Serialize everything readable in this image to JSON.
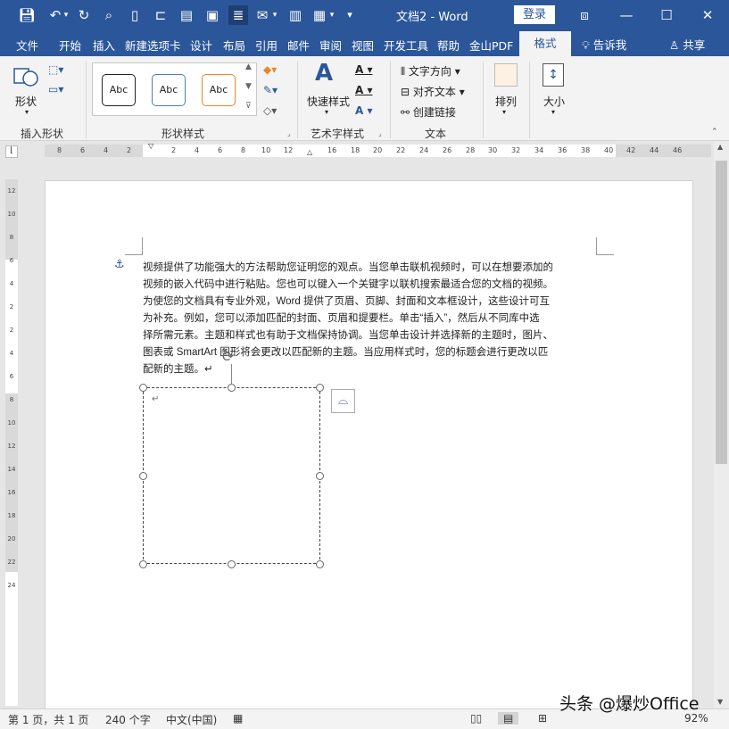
{
  "titlebar": {
    "doc_title": "文档2  -  Word",
    "login_label": "登录"
  },
  "tabs": [
    "文件",
    "开始",
    "插入",
    "新建选项卡",
    "设计",
    "布局",
    "引用",
    "邮件",
    "审阅",
    "视图",
    "开发工具",
    "帮助",
    "金山PDF",
    "格式"
  ],
  "tell_me": "告诉我",
  "share": "共享",
  "ribbon": {
    "insert_shapes": {
      "shape_label": "形状",
      "group_label": "插入形状"
    },
    "shape_styles": {
      "sample_text": "Abc",
      "group_label": "形状样式"
    },
    "wordart": {
      "quick_styles_label": "快速样式",
      "group_label": "艺术字样式"
    },
    "text": {
      "direction_label": "文字方向",
      "align_label": "对齐文本",
      "link_label": "创建链接",
      "group_label": "文本"
    },
    "arrange": {
      "label": "排列"
    },
    "size": {
      "label": "大小"
    }
  },
  "ruler_h": [
    "8",
    "6",
    "4",
    "2",
    "2",
    "4",
    "6",
    "8",
    "10",
    "12",
    "16",
    "18",
    "20",
    "22",
    "24",
    "26",
    "28",
    "30",
    "32",
    "34",
    "36",
    "38",
    "40",
    "42",
    "44",
    "46"
  ],
  "ruler_v": [
    "12",
    "10",
    "8",
    "6",
    "4",
    "2",
    "2",
    "4",
    "6",
    "8",
    "10",
    "12",
    "14",
    "16",
    "18",
    "20",
    "22",
    "24"
  ],
  "document": {
    "lines": [
      "视频提供了功能强大的方法帮助您证明您的观点。当您单击联机视频时，可以在想要添加的",
      "视频的嵌入代码中进行粘贴。您也可以键入一个关键字以联机搜索最适合您的文档的视频。",
      "为使您的文档具有专业外观，Word 提供了页眉、页脚、封面和文本框设计，这些设计可互",
      "为补充。例如，您可以添加匹配的封面、页眉和提要栏。单击“插入”，然后从不同库中选",
      "择所需元素。主题和样式也有助于文档保持协调。当您单击设计并选择新的主题时，图片、",
      "图表或 SmartArt 图形将会更改以匹配新的主题。当应用样式时，您的标题会进行更改以匹",
      "配新的主题。↵"
    ],
    "textbox_mark": "↵"
  },
  "status": {
    "page": "第 1 页，共 1 页",
    "words": "240 个字",
    "language": "中文(中国)",
    "zoom": "92%"
  },
  "watermark": "头条 @爆炒Office",
  "colors": {
    "brand": "#2b579a",
    "ribbon": "#f3f3f3"
  }
}
